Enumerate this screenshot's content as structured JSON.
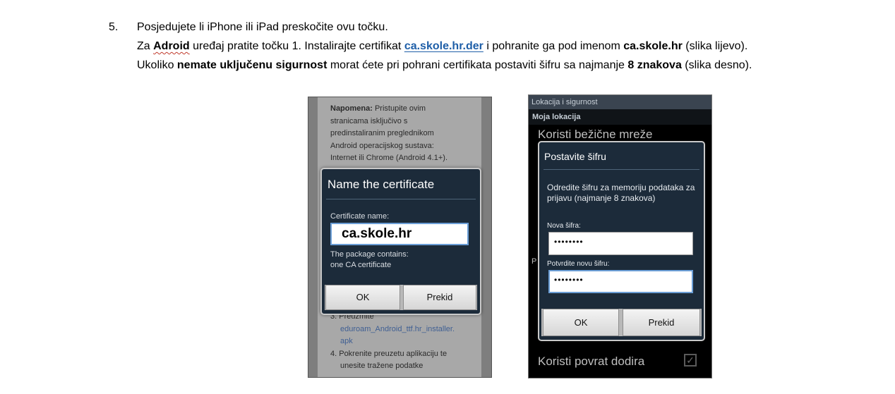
{
  "doc": {
    "item_number": "5.",
    "line1": "Posjedujete li iPhone ili iPad preskočite ovu točku.",
    "line2": {
      "p1": "Za ",
      "b1": "Adroid",
      "p2": " uređaj pratite točku 1. Instalirajte certifikat ",
      "link": "ca.skole.hr.der",
      "p3": " i pohranite ga pod imenom ",
      "b2": "ca.skole.hr",
      "p4": " (slika lijevo)."
    },
    "line3": {
      "p1": "Ukoliko ",
      "b1": "nemate uključenu sigurnost",
      "p2": " morat ćete pri pohrani certifikata postaviti šifru sa najmanje ",
      "b2": "8 znakova",
      "p3": " (slika desno)."
    }
  },
  "left_screen": {
    "note_bold": "Napomena:",
    "note_lines": [
      " Pristupite ovim",
      "stranicama isključivo s",
      "predinstaliranim preglednikom",
      "Android operacijskog sustava:",
      "Internet ili Chrome (Android 4.1+)."
    ],
    "step3_prefix": "3. Preuzmite",
    "step3_link": [
      "eduroam_Android_ttf.hr_installer.",
      "apk"
    ],
    "step4": [
      "4. Pokrenite preuzetu aplikaciju te",
      "unesite tražene podatke"
    ],
    "dialog": {
      "title": "Name the certificate",
      "field_label": "Certificate name:",
      "field_value": "ca.skole.hr",
      "info_lines": [
        "The package contains:",
        "one CA certificate"
      ],
      "ok_button": "OK",
      "cancel_button": "Prekid"
    }
  },
  "right_screen": {
    "header": "Lokacija i sigurnost",
    "section": "Moja lokacija",
    "bg_item_top": "Koristi bežične mreže",
    "bg_letter": "P",
    "bg_item_bottom": "Koristi povrat dodira",
    "dialog": {
      "title": "Postavite šifru",
      "description": "Odredite šifru za memoriju podataka za prijavu (najmanje 8 znakova)",
      "new_label": "Nova šifra:",
      "new_value": "••••••••",
      "confirm_label": "Potvrdite novu šifru:",
      "confirm_value": "••••••••",
      "ok_button": "OK",
      "cancel_button": "Prekid"
    }
  }
}
